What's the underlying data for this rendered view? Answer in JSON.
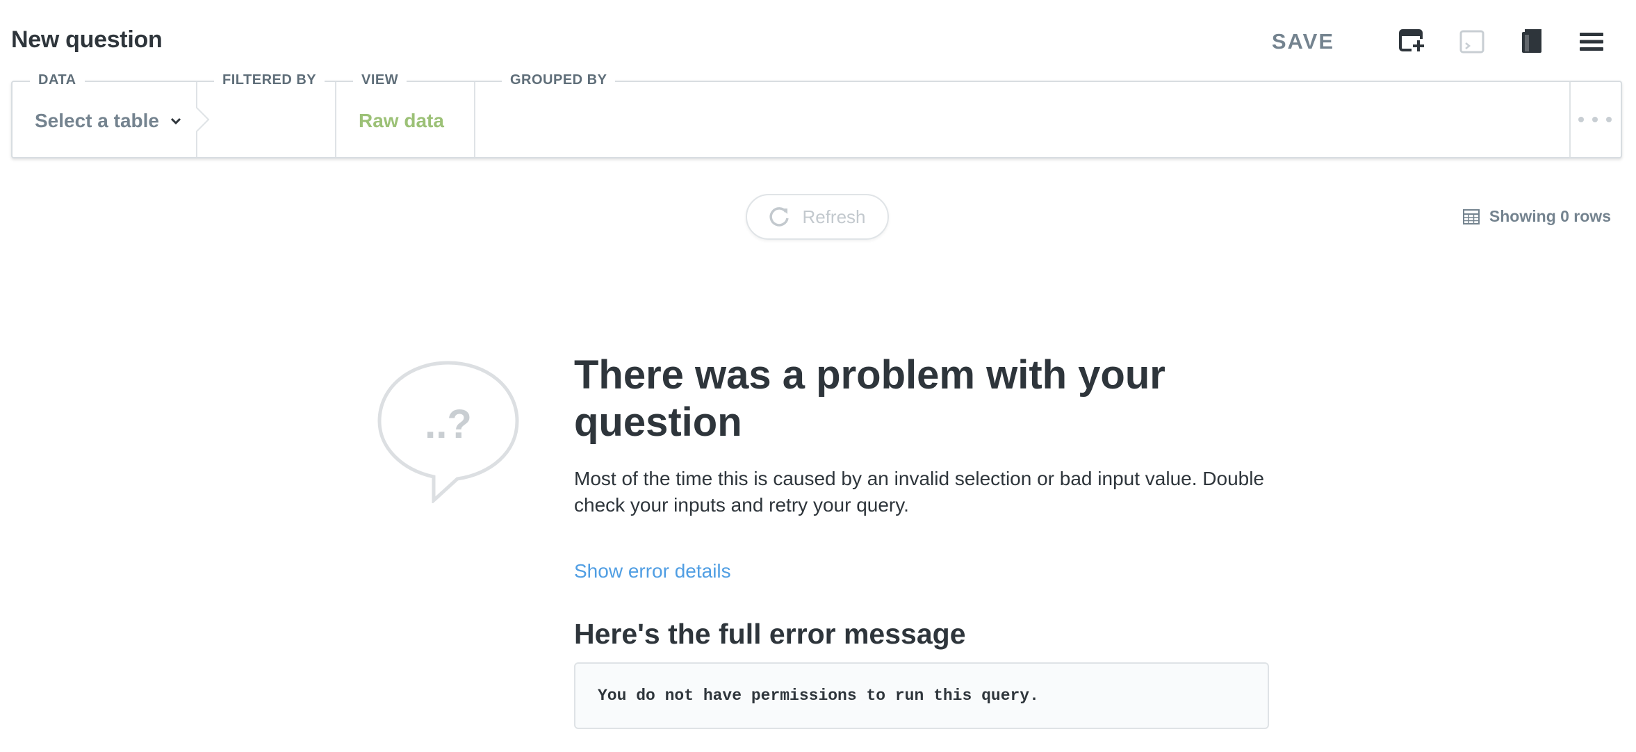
{
  "header": {
    "title": "New question",
    "save_label": "SAVE",
    "icons": [
      "add-to-dashboard-icon",
      "native-query-icon",
      "reference-book-icon",
      "menu-icon"
    ]
  },
  "query_builder": {
    "data_label": "DATA",
    "data_value": "Select a table",
    "filter_label": "FILTERED BY",
    "view_label": "VIEW",
    "view_value": "Raw data",
    "group_label": "GROUPED BY",
    "more_icon": "ellipsis-icon"
  },
  "results": {
    "refresh_label": "Refresh",
    "rows_label": "Showing 0 rows"
  },
  "error": {
    "bubble_text": "..?",
    "title": "There was a problem with your question",
    "description": "Most of the time this is caused by an invalid selection or bad input value. Double check your inputs and retry your query.",
    "details_link": "Show error details",
    "full_heading": "Here's the full error message",
    "message": "You do not have permissions to run this query."
  },
  "colors": {
    "text_dark": "#2e353b",
    "text_muted": "#74838f",
    "accent_green": "#9cc177",
    "link_blue": "#509ee3",
    "border": "#d8dde1"
  }
}
